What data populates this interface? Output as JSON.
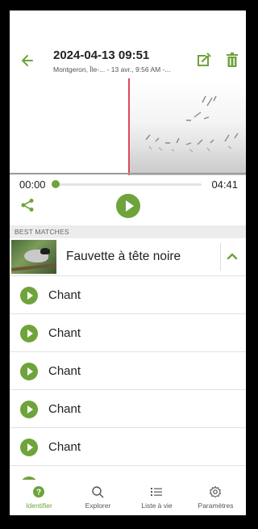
{
  "header": {
    "title": "2024-04-13 09:51",
    "subtitle": "Montgeron, Île-... - 13 avr., 9:56 AM -..."
  },
  "player": {
    "elapsed": "00:00",
    "duration": "04:41",
    "progress": 0
  },
  "section": {
    "best_matches_label": "BEST MATCHES"
  },
  "match": {
    "species_name": "Fauvette à tête noire"
  },
  "recordings": [
    {
      "label": "Chant"
    },
    {
      "label": "Chant"
    },
    {
      "label": "Chant"
    },
    {
      "label": "Chant"
    },
    {
      "label": "Chant"
    }
  ],
  "bottom_nav": [
    {
      "label": "Identifier",
      "icon": "help-circle-icon",
      "active": true
    },
    {
      "label": "Explorer",
      "icon": "search-icon",
      "active": false
    },
    {
      "label": "Liste à vie",
      "icon": "list-icon",
      "active": false
    },
    {
      "label": "Paramètres",
      "icon": "gear-icon",
      "active": false
    }
  ],
  "colors": {
    "accent": "#6fa33b",
    "cursor": "#e0485a"
  }
}
